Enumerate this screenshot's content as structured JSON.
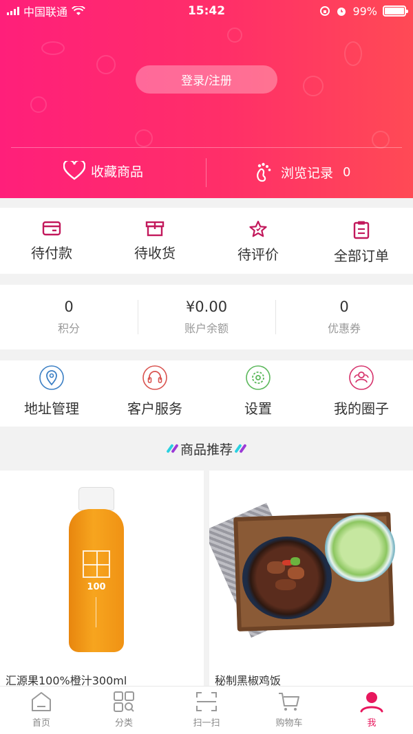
{
  "status_bar": {
    "carrier": "中国联通",
    "time": "15:42",
    "battery": "99%"
  },
  "header": {
    "login_label": "登录/注册",
    "favorites_label": "收藏商品",
    "history_label": "浏览记录",
    "history_count": "0"
  },
  "orders": [
    {
      "label": "待付款",
      "icon": "wallet-icon"
    },
    {
      "label": "待收货",
      "icon": "package-icon"
    },
    {
      "label": "待评价",
      "icon": "star-icon"
    },
    {
      "label": "全部订单",
      "icon": "clipboard-icon"
    }
  ],
  "assets": [
    {
      "value": "0",
      "caption": "积分"
    },
    {
      "value": "¥0.00",
      "caption": "账户余额"
    },
    {
      "value": "0",
      "caption": "优惠券"
    }
  ],
  "services": [
    {
      "label": "地址管理",
      "icon": "location-icon",
      "color": "#3b7fc4"
    },
    {
      "label": "客户服务",
      "icon": "headset-icon",
      "color": "#d9534f"
    },
    {
      "label": "设置",
      "icon": "gear-icon",
      "color": "#5cb85c"
    },
    {
      "label": "我的圈子",
      "icon": "community-icon",
      "color": "#d6336c"
    }
  ],
  "recommend": {
    "title": "商品推荐",
    "products": [
      {
        "name": "汇源果100%橙汁300ml",
        "bottle_text": "100"
      },
      {
        "name": "秘制黑椒鸡饭"
      }
    ]
  },
  "tabbar": {
    "tabs": [
      {
        "label": "首页",
        "icon": "home-icon"
      },
      {
        "label": "分类",
        "icon": "category-icon"
      },
      {
        "label": "扫一扫",
        "icon": "scan-icon"
      },
      {
        "label": "购物车",
        "icon": "cart-icon"
      },
      {
        "label": "我",
        "icon": "profile-icon",
        "active": true
      }
    ]
  },
  "colors": {
    "brand": "#ff2a6d",
    "active_tab": "#e8175d",
    "order_icon": "#c2185b"
  }
}
